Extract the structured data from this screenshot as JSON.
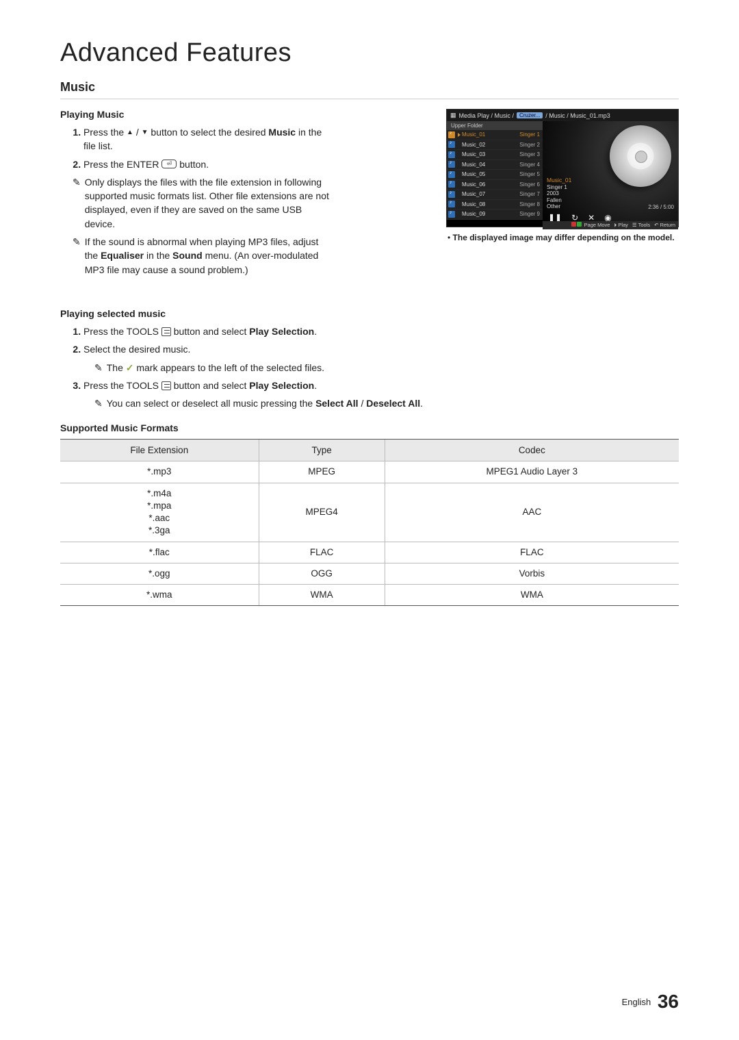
{
  "title": "Advanced Features",
  "section": "Music",
  "playing_heading": "Playing Music",
  "step1a": "Press the ",
  "step1b": " / ",
  "step1c": " button to select the desired ",
  "step1_bold": "Music",
  "step1d": " in the file list.",
  "step2a": "Press the ",
  "step2_enter": "ENTER",
  "step2b": " button.",
  "note1": "Only displays the files with the file extension in following supported music formats list. Other file extensions are not displayed, even if they are saved on the same USB device.",
  "note2a": "If the sound is abnormal when playing MP3 files, adjust the ",
  "note2b1": "Equaliser",
  "note2c": " in the ",
  "note2b2": "Sound",
  "note2d": " menu. (An over-modulated MP3 file may cause a sound problem.)",
  "selected_heading": "Playing selected music",
  "s1a": "Press the ",
  "s_tools": "TOOLS",
  "s1b": " button and select ",
  "s_playsel": "Play Selection",
  "s1c": ".",
  "s2": "Select the desired music.",
  "s2n": " mark appears to the left of the selected files.",
  "s2n_pre": "The ",
  "s3n": "You can select or deselect all music pressing the ",
  "s3n_b1": "Select All",
  "s3n_mid": " / ",
  "s3n_b2": "Deselect All",
  "s3n_end": ".",
  "fmt_heading": "Supported Music Formats",
  "fmt_headers": [
    "File Extension",
    "Type",
    "Codec"
  ],
  "fmt_rows": [
    {
      "ext": "*.mp3",
      "type": "MPEG",
      "codec": "MPEG1 Audio Layer 3"
    },
    {
      "ext": "*.m4a\n*.mpa\n*.aac\n*.3ga",
      "type": "MPEG4",
      "codec": "AAC"
    },
    {
      "ext": "*.flac",
      "type": "FLAC",
      "codec": "FLAC"
    },
    {
      "ext": "*.ogg",
      "type": "OGG",
      "codec": "Vorbis"
    },
    {
      "ext": "*.wma",
      "type": "WMA",
      "codec": "WMA"
    }
  ],
  "shot": {
    "path_a": "Media Play / Music / ",
    "path_usb": "Cruzer...",
    "path_b": " / Music / Music_01.mp3",
    "upper": "Upper Folder",
    "items": [
      {
        "n": "Music_01",
        "s": "Singer 1",
        "sel": true
      },
      {
        "n": "Music_02",
        "s": "Singer 2"
      },
      {
        "n": "Music_03",
        "s": "Singer 3"
      },
      {
        "n": "Music_04",
        "s": "Singer 4"
      },
      {
        "n": "Music_05",
        "s": "Singer 5"
      },
      {
        "n": "Music_06",
        "s": "Singer 6"
      },
      {
        "n": "Music_07",
        "s": "Singer 7"
      },
      {
        "n": "Music_08",
        "s": "Singer 8"
      },
      {
        "n": "Music_09",
        "s": "Singer 9"
      }
    ],
    "meta_title": "Music_01",
    "meta1": "Singer 1",
    "meta2": "2003",
    "meta3": "Fallen",
    "meta4": "Other",
    "time": "2:36 / 5:00",
    "legend": {
      "pm": "Page Move",
      "play": "Play",
      "tools": "Tools",
      "ret": "Return"
    }
  },
  "caption": "The displayed image may differ depending on the model.",
  "footer_lang": "English",
  "footer_page": "36"
}
